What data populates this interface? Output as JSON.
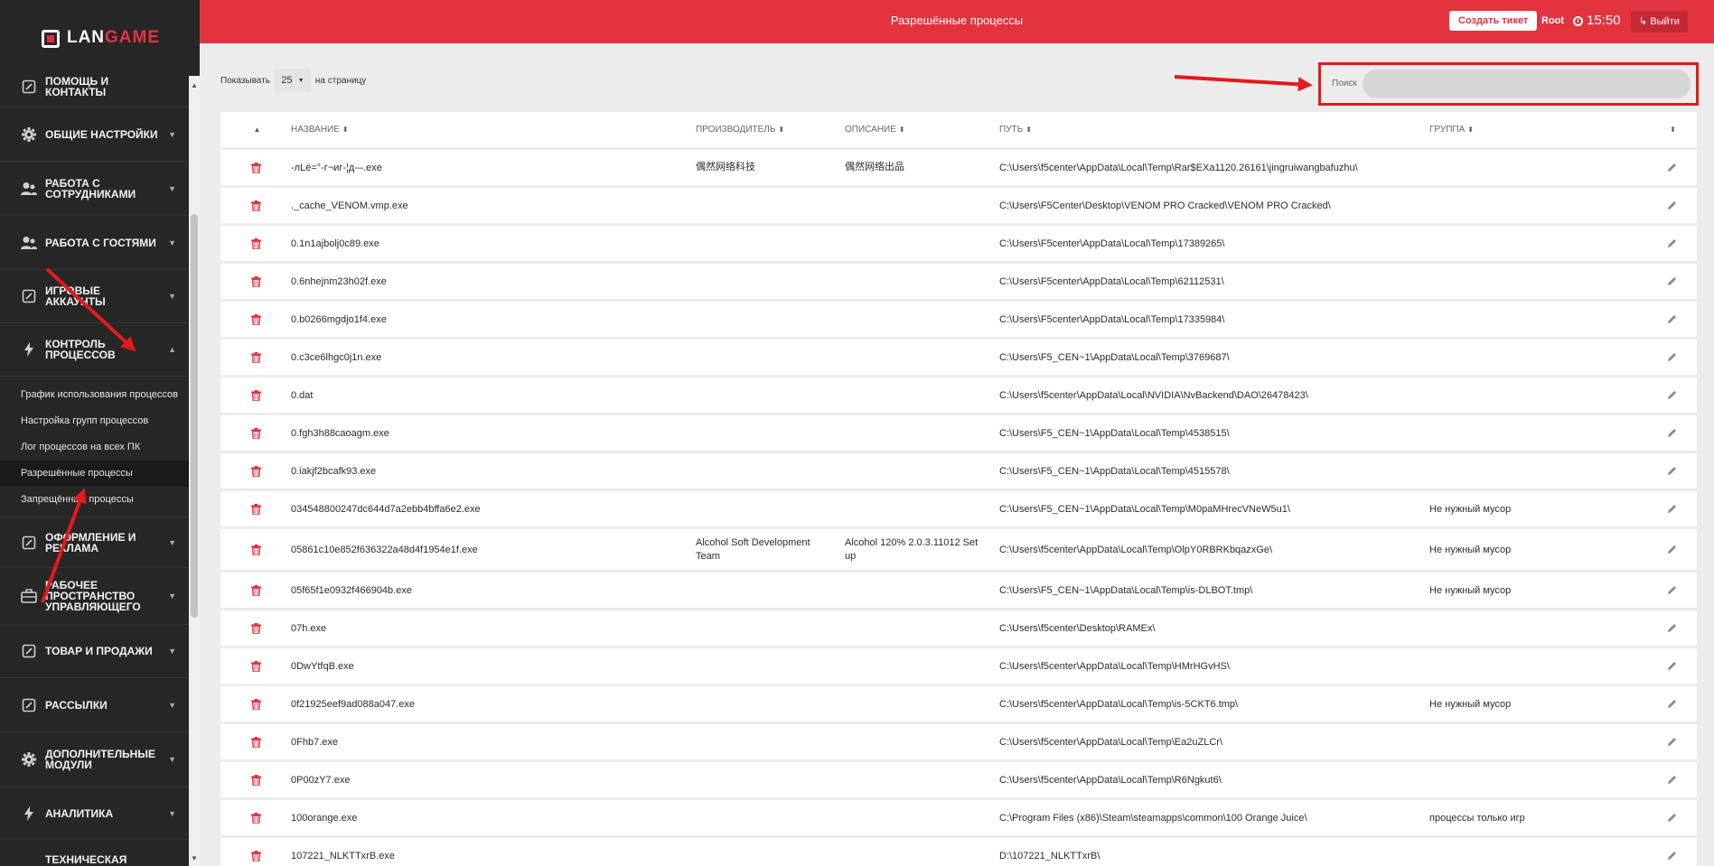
{
  "brand": {
    "logo_left": "LAN",
    "logo_right": "GAME"
  },
  "sidebar": {
    "items_top": [
      {
        "label": "Помощь и контакты",
        "icon": "edit-square-icon",
        "caret": ""
      },
      {
        "label": "Общие настройки",
        "icon": "gear-icon",
        "caret": "▼"
      },
      {
        "label": "Работа с сотрудниками",
        "icon": "users-icon",
        "caret": "▼"
      },
      {
        "label": "Работа с гостями",
        "icon": "users-icon",
        "caret": "▼"
      },
      {
        "label": "Игровые аккаунты",
        "icon": "edit-square-icon",
        "caret": "▼"
      },
      {
        "label": "Контроль процессов",
        "icon": "bolt-icon",
        "caret": "▲"
      }
    ],
    "sub_items": [
      {
        "label": "График использования процессов"
      },
      {
        "label": "Настройка групп процессов"
      },
      {
        "label": "Лог процессов на всех ПК"
      },
      {
        "label": "Разрешённые процессы"
      },
      {
        "label": "Запрещённые процессы"
      }
    ],
    "items_bottom": [
      {
        "label": "Оформление и реклама",
        "icon": "edit-square-icon",
        "caret": "▼"
      },
      {
        "label": "Рабочее пространство управляющего",
        "icon": "briefcase-icon",
        "caret": "▼"
      },
      {
        "label": "Товар и продажи",
        "icon": "edit-square-icon",
        "caret": "▼"
      },
      {
        "label": "Рассылки",
        "icon": "edit-square-icon",
        "caret": "▼"
      },
      {
        "label": "Дополнительные модули",
        "icon": "gear-icon",
        "caret": "▼"
      },
      {
        "label": "Аналитика",
        "icon": "bolt-icon",
        "caret": "▼"
      },
      {
        "label": "Техническая статистика домена",
        "icon": "",
        "caret": ""
      }
    ]
  },
  "header": {
    "title": "Разрешённые процессы",
    "ticket_button": "Создать тикет",
    "user": "Root",
    "time": "15:50",
    "logout": "Выйти"
  },
  "controls": {
    "show_label": "Показывать",
    "per_page": "25",
    "per_page_suffix": "на страницу",
    "search_label": "Поиск",
    "search_value": ""
  },
  "table": {
    "columns": [
      "",
      "Название",
      "Производитель",
      "Описание",
      "Путь",
      "Группа",
      ""
    ],
    "rows": [
      {
        "name": "-лLё=°-г¬иг-¦д-–.exe",
        "maker": "偶然网络科技",
        "desc": "偶然网络出品",
        "path": "C:\\Users\\f5center\\AppData\\Local\\Temp\\Rar$EXa1120.26161\\jingruiwangbafuzhu\\",
        "group": ""
      },
      {
        "name": "._cache_VENOM.vmp.exe",
        "maker": "",
        "desc": "",
        "path": "C:\\Users\\F5Center\\Desktop\\VENOM PRO Cracked\\VENOM PRO Cracked\\",
        "group": ""
      },
      {
        "name": "0.1n1ajbolj0c89.exe",
        "maker": "",
        "desc": "",
        "path": "C:\\Users\\F5center\\AppData\\Local\\Temp\\17389265\\",
        "group": ""
      },
      {
        "name": "0.6nhejnm23h02f.exe",
        "maker": "",
        "desc": "",
        "path": "C:\\Users\\F5center\\AppData\\Local\\Temp\\62112531\\",
        "group": ""
      },
      {
        "name": "0.b0266mgdjo1f4.exe",
        "maker": "",
        "desc": "",
        "path": "C:\\Users\\F5center\\AppData\\Local\\Temp\\17335984\\",
        "group": ""
      },
      {
        "name": "0.c3ce6lhgc0j1n.exe",
        "maker": "",
        "desc": "",
        "path": "C:\\Users\\F5_CEN~1\\AppData\\Local\\Temp\\3769687\\",
        "group": ""
      },
      {
        "name": "0.dat",
        "maker": "",
        "desc": "",
        "path": "C:\\Users\\f5center\\AppData\\Local\\NVIDIA\\NvBackend\\DAO\\26478423\\",
        "group": ""
      },
      {
        "name": "0.fgh3h88caoagm.exe",
        "maker": "",
        "desc": "",
        "path": "C:\\Users\\F5_CEN~1\\AppData\\Local\\Temp\\4538515\\",
        "group": ""
      },
      {
        "name": "0.iakjf2bcafk93.exe",
        "maker": "",
        "desc": "",
        "path": "C:\\Users\\F5_CEN~1\\AppData\\Local\\Temp\\4515578\\",
        "group": ""
      },
      {
        "name": "034548800247dc644d7a2ebb4bffa6e2.exe",
        "maker": "",
        "desc": "",
        "path": "C:\\Users\\F5_CEN~1\\AppData\\Local\\Temp\\M0paMHrecVNeW5u1\\",
        "group": "Не нужный мусор"
      },
      {
        "name": "05861c10e852f636322a48d4f1954e1f.exe",
        "maker": "Alcohol Soft Development Team",
        "desc": "Alcohol 120% 2.0.3.11012 Set up",
        "path": "C:\\Users\\f5center\\AppData\\Local\\Temp\\OlpY0RBRKbqazxGe\\",
        "group": "Не нужный мусор",
        "tall": true
      },
      {
        "name": "05f65f1e0932f466904b.exe",
        "maker": "",
        "desc": "",
        "path": "C:\\Users\\F5_CEN~1\\AppData\\Local\\Temp\\is-DLBOT.tmp\\",
        "group": "Не нужный мусор"
      },
      {
        "name": "07h.exe",
        "maker": "",
        "desc": "",
        "path": "C:\\Users\\f5center\\Desktop\\RAMEx\\",
        "group": ""
      },
      {
        "name": "0DwYtfqB.exe",
        "maker": "",
        "desc": "",
        "path": "C:\\Users\\f5center\\AppData\\Local\\Temp\\HMrHGvHS\\",
        "group": ""
      },
      {
        "name": "0f21925eef9ad088a047.exe",
        "maker": "",
        "desc": "",
        "path": "C:\\Users\\f5center\\AppData\\Local\\Temp\\is-5CKT6.tmp\\",
        "group": "Не нужный мусор"
      },
      {
        "name": "0Fhb7.exe",
        "maker": "",
        "desc": "",
        "path": "C:\\Users\\f5center\\AppData\\Local\\Temp\\Ea2uZLCr\\",
        "group": ""
      },
      {
        "name": "0P00zY7.exe",
        "maker": "",
        "desc": "",
        "path": "C:\\Users\\f5center\\AppData\\Local\\Temp\\R6Ngkut6\\",
        "group": ""
      },
      {
        "name": "100orange.exe",
        "maker": "",
        "desc": "",
        "path": "C:\\Program Files (x86)\\Steam\\steamapps\\common\\100 Orange Juice\\",
        "group": "процессы только игр"
      },
      {
        "name": "107221_NLKTTxrB.exe",
        "maker": "",
        "desc": "",
        "path": "D:\\107221_NLKTTxrB\\",
        "group": ""
      }
    ]
  },
  "colors": {
    "accent": "#e2333f",
    "sidebar_bg": "#272727",
    "annotation_red": "#e21b1b"
  }
}
